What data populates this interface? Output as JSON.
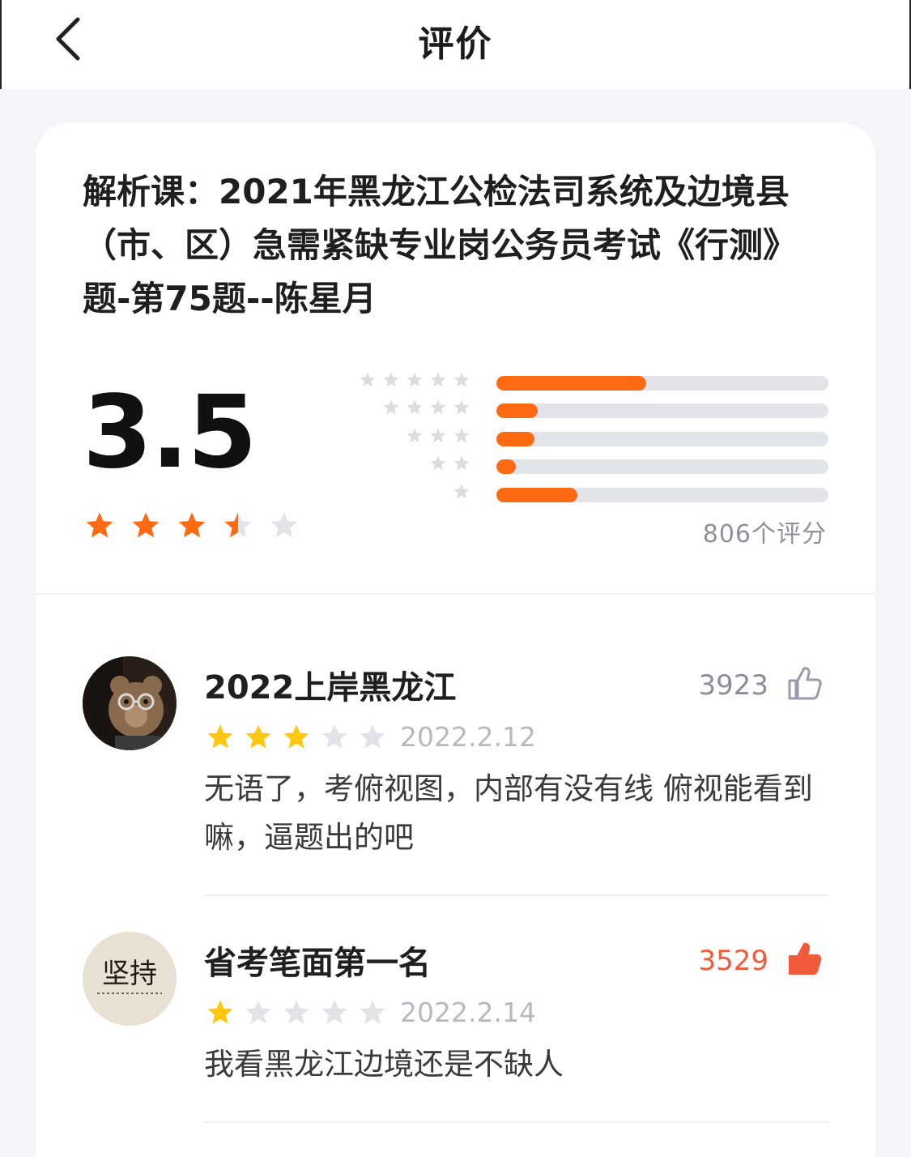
{
  "header": {
    "title": "评价",
    "back_icon": "chevron-left-icon"
  },
  "course": {
    "title": "解析课：2021年黑龙江公检法司系统及边境县（市、区）急需紧缺专业岗公务员考试《行测》题-第75题--陈星月"
  },
  "summary": {
    "score": "3.5",
    "score_value": 3.5,
    "rating_count": "806个评分",
    "distribution": [
      {
        "stars": 5,
        "fraction": 0.45
      },
      {
        "stars": 4,
        "fraction": 0.125
      },
      {
        "stars": 3,
        "fraction": 0.115
      },
      {
        "stars": 2,
        "fraction": 0.058
      },
      {
        "stars": 1,
        "fraction": 0.245
      }
    ]
  },
  "colors": {
    "accent_orange": "#ff6a13",
    "review_star_yellow": "#ffc70f",
    "star_empty": "#e2e3e9",
    "like_active": "#f25a3c"
  },
  "reviews": [
    {
      "name": "2022上岸黑龙江",
      "likes": "3923",
      "liked": false,
      "rating": 3,
      "date": "2022.2.12",
      "text": "无语了，考俯视图，内部有没有线 俯视能看到嘛，逼题出的吧",
      "avatar": "teddy-bear-avatar"
    },
    {
      "name": "省考笔面第一名",
      "likes": "3529",
      "liked": true,
      "rating": 1,
      "date": "2022.2.14",
      "text": "我看黑龙江边境还是不缺人",
      "avatar": "calligraphy-avatar",
      "avatar_text": "坚持"
    }
  ]
}
